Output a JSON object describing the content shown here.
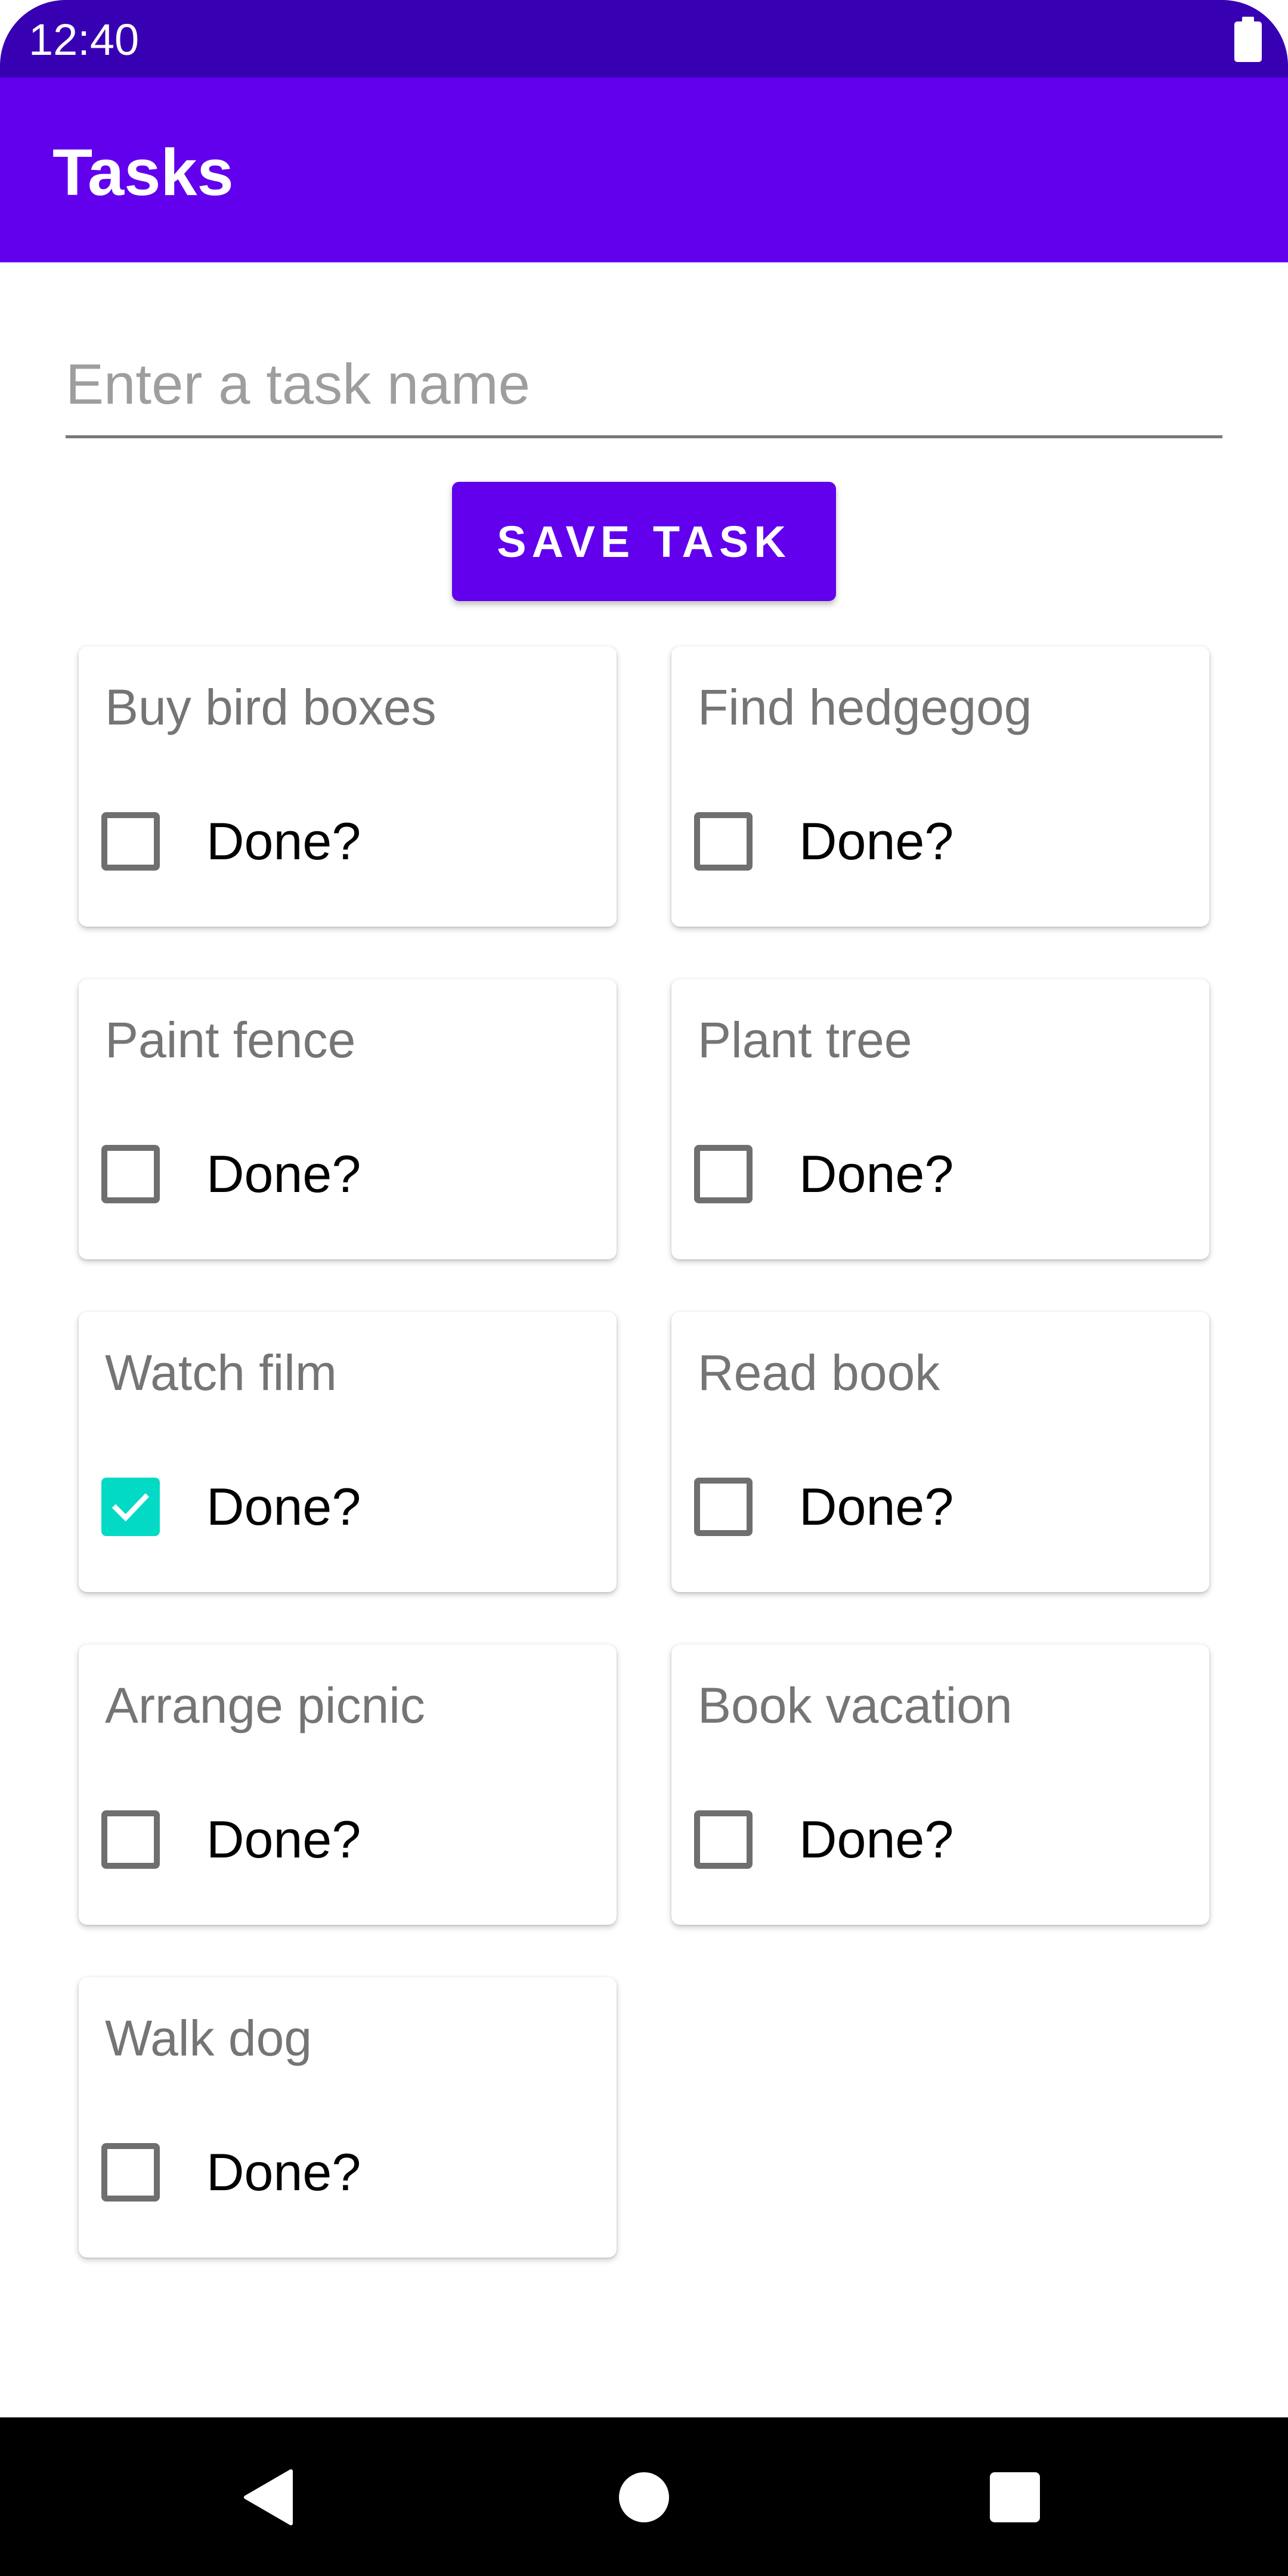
{
  "status_bar": {
    "time": "12:40",
    "battery_icon": "battery-full-icon"
  },
  "app_bar": {
    "title": "Tasks"
  },
  "input": {
    "placeholder": "Enter a task name",
    "value": ""
  },
  "save_button": {
    "label": "SAVE TASK"
  },
  "tasks": [
    {
      "name": "Buy bird boxes",
      "done_label": "Done?",
      "done": false
    },
    {
      "name": "Find hedgegog",
      "done_label": "Done?",
      "done": false
    },
    {
      "name": "Paint fence",
      "done_label": "Done?",
      "done": false
    },
    {
      "name": "Plant tree",
      "done_label": "Done?",
      "done": false
    },
    {
      "name": "Watch film",
      "done_label": "Done?",
      "done": true
    },
    {
      "name": "Read book",
      "done_label": "Done?",
      "done": false
    },
    {
      "name": "Arrange picnic",
      "done_label": "Done?",
      "done": false
    },
    {
      "name": "Book vacation",
      "done_label": "Done?",
      "done": false
    },
    {
      "name": "Walk dog",
      "done_label": "Done?",
      "done": false
    }
  ],
  "nav_bar": {
    "back_icon": "back-triangle-icon",
    "home_icon": "home-circle-icon",
    "recents_icon": "recents-square-icon"
  },
  "colors": {
    "status_bar": "#3700b3",
    "primary": "#6200ee",
    "checkbox_checked": "#03dac5",
    "nav_bar": "#000000"
  }
}
